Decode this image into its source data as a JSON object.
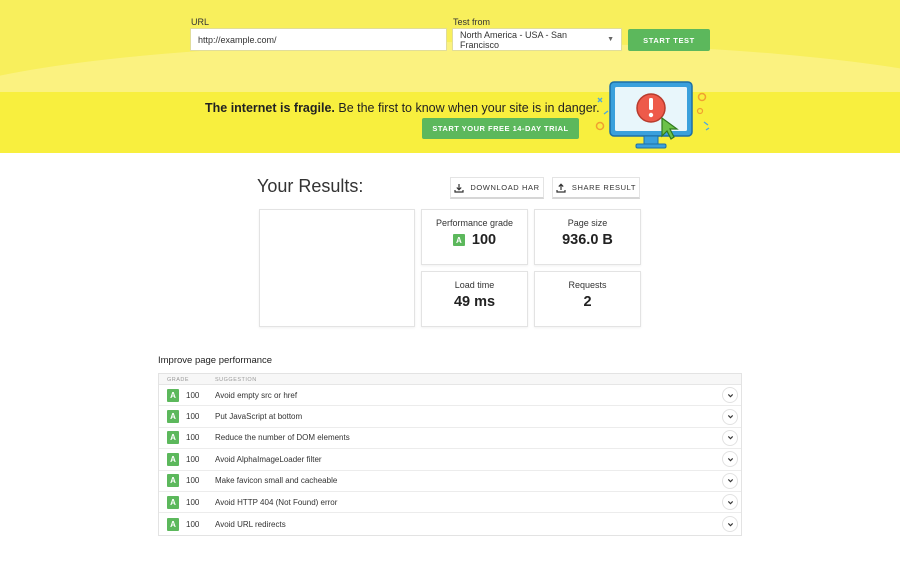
{
  "colors": {
    "hero_yellow": "#f8ef5c",
    "promo_yellow": "#f8ef3e",
    "accent_green": "#5cb85c"
  },
  "hero": {
    "url_label": "URL",
    "url_value": "http://example.com/",
    "test_from_label": "Test from",
    "location_selected": "North America - USA - San Francisco",
    "start_button": "START TEST"
  },
  "promo": {
    "headline_bold": "The internet is fragile.",
    "headline_rest": " Be the first to know when your site is in danger.",
    "trial_button": "START YOUR FREE 14-DAY TRIAL",
    "illustration_icon": "monitor-alert-icon"
  },
  "results": {
    "title": "Your Results:",
    "download_har": "DOWNLOAD HAR",
    "share_result": "SHARE RESULT",
    "metrics": {
      "performance_grade_label": "Performance grade",
      "performance_grade_letter": "A",
      "performance_grade_value": "100",
      "page_size_label": "Page size",
      "page_size_value": "936.0 B",
      "load_time_label": "Load time",
      "load_time_value": "49 ms",
      "requests_label": "Requests",
      "requests_value": "2"
    }
  },
  "improve": {
    "title": "Improve page performance",
    "col_grade": "GRADE",
    "col_suggestion": "SUGGESTION",
    "rows": [
      {
        "grade": "A",
        "score": "100",
        "suggestion": "Avoid empty src or href"
      },
      {
        "grade": "A",
        "score": "100",
        "suggestion": "Put JavaScript at bottom"
      },
      {
        "grade": "A",
        "score": "100",
        "suggestion": "Reduce the number of DOM elements"
      },
      {
        "grade": "A",
        "score": "100",
        "suggestion": "Avoid AlphaImageLoader filter"
      },
      {
        "grade": "A",
        "score": "100",
        "suggestion": "Make favicon small and cacheable"
      },
      {
        "grade": "A",
        "score": "100",
        "suggestion": "Avoid HTTP 404 (Not Found) error"
      },
      {
        "grade": "A",
        "score": "100",
        "suggestion": "Avoid URL redirects"
      }
    ]
  }
}
